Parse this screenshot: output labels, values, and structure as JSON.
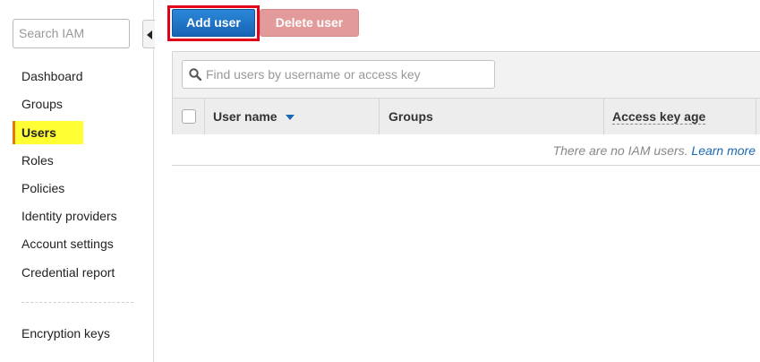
{
  "sidebar": {
    "search_placeholder": "Search IAM",
    "items": [
      {
        "label": "Dashboard"
      },
      {
        "label": "Groups"
      },
      {
        "label": "Users"
      },
      {
        "label": "Roles"
      },
      {
        "label": "Policies"
      },
      {
        "label": "Identity providers"
      },
      {
        "label": "Account settings"
      },
      {
        "label": "Credential report"
      }
    ],
    "active_item": "Users",
    "secondary_items": [
      {
        "label": "Encryption keys"
      }
    ]
  },
  "toolbar": {
    "add_label": "Add user",
    "delete_label": "Delete user"
  },
  "filter": {
    "placeholder": "Find users by username or access key"
  },
  "table": {
    "columns": [
      "User name",
      "Groups",
      "Access key age"
    ],
    "rows": [],
    "empty_text": "There are no IAM users.",
    "empty_link": "Learn more"
  },
  "colors": {
    "primary": "#1764b5",
    "danger_disabled": "#e39a9a",
    "highlight": "#ffff33",
    "link": "#1a6ab3"
  }
}
